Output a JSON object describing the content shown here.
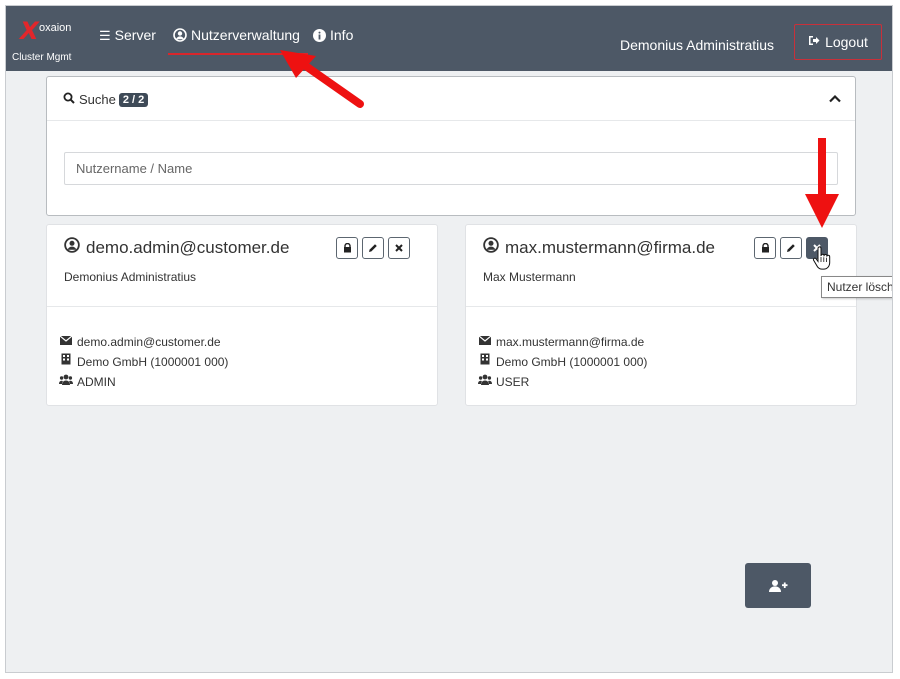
{
  "brand": {
    "mark": "X",
    "name": "oxaion",
    "subtitle": "Cluster Mgmt"
  },
  "nav": {
    "items": [
      {
        "label": "Server",
        "icon": "server-list-icon"
      },
      {
        "label": "Nutzerverwaltung",
        "icon": "user-circle-icon",
        "active": true
      },
      {
        "label": "Info",
        "icon": "info-circle-icon"
      }
    ],
    "current_user": "Demonius Administratius",
    "logout_label": "Logout"
  },
  "search": {
    "title": "Suche",
    "badge": "2 / 2",
    "placeholder": "Nutzername / Name",
    "value": ""
  },
  "users": [
    {
      "email": "demo.admin@customer.de",
      "full_name": "Demonius Administratius",
      "contact_email": "demo.admin@customer.de",
      "company": "Demo GmbH (1000001 000)",
      "role": "ADMIN"
    },
    {
      "email": "max.mustermann@firma.de",
      "full_name": "Max Mustermann",
      "contact_email": "max.mustermann@firma.de",
      "company": "Demo GmbH (1000001 000)",
      "role": "USER"
    }
  ],
  "tooltip": "Nutzer lösch",
  "colors": {
    "navbar": "#4d5866",
    "accent_red": "#d9262b",
    "arrow_red": "#ee1111"
  }
}
